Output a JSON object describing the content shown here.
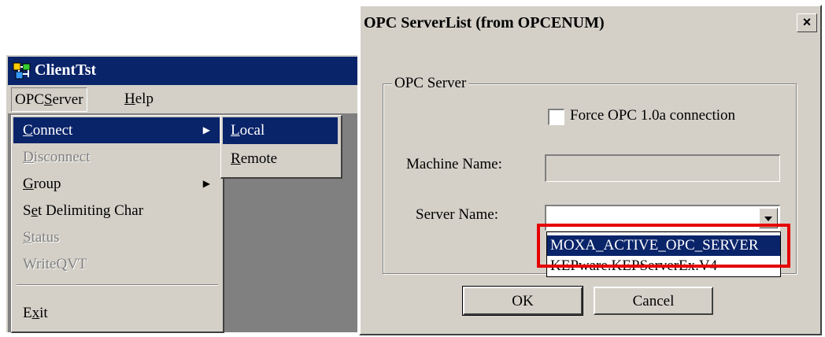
{
  "client_window": {
    "title": "ClientTst",
    "menubar": {
      "opcserver_label": "OPCServer",
      "help_label": "Help"
    },
    "opcserver_menu": [
      {
        "label": "Connect",
        "state": "selected",
        "has_submenu": true
      },
      {
        "label": "Disconnect",
        "state": "disabled",
        "has_submenu": false
      },
      {
        "label": "Group",
        "state": "normal",
        "has_submenu": true
      },
      {
        "label": "Set Delimiting Char",
        "state": "normal",
        "has_submenu": false
      },
      {
        "label": "Status",
        "state": "disabled",
        "has_submenu": false
      },
      {
        "label": "WriteQVT",
        "state": "disabled",
        "has_submenu": false
      },
      {
        "label": "Exit",
        "state": "normal",
        "has_submenu": false
      }
    ],
    "connect_submenu": [
      {
        "label": "Local",
        "state": "selected"
      },
      {
        "label": "Remote",
        "state": "normal"
      }
    ],
    "icons": {
      "app": "app-icon",
      "submenu_arrow": "chevron-right-icon"
    }
  },
  "dialog": {
    "title": "OPC ServerList (from OPCENUM)",
    "close_label": "×",
    "group_label": "OPC Server",
    "force_checkbox": {
      "label": "Force OPC 1.0a connection",
      "checked": false
    },
    "machine_name": {
      "label": "Machine Name:",
      "value": ""
    },
    "server_name": {
      "label": "Server Name:",
      "value": "",
      "options": [
        "MOXA_ACTIVE_OPC_SERVER",
        "KEPware.KEPServerEx.V4"
      ],
      "selected_index": 0
    },
    "ok_label": "OK",
    "cancel_label": "Cancel",
    "highlight_color": "#e60000"
  },
  "colors": {
    "titlebar_active": "#0a246a",
    "face": "#d4d0c8",
    "highlight": "#e60000"
  }
}
